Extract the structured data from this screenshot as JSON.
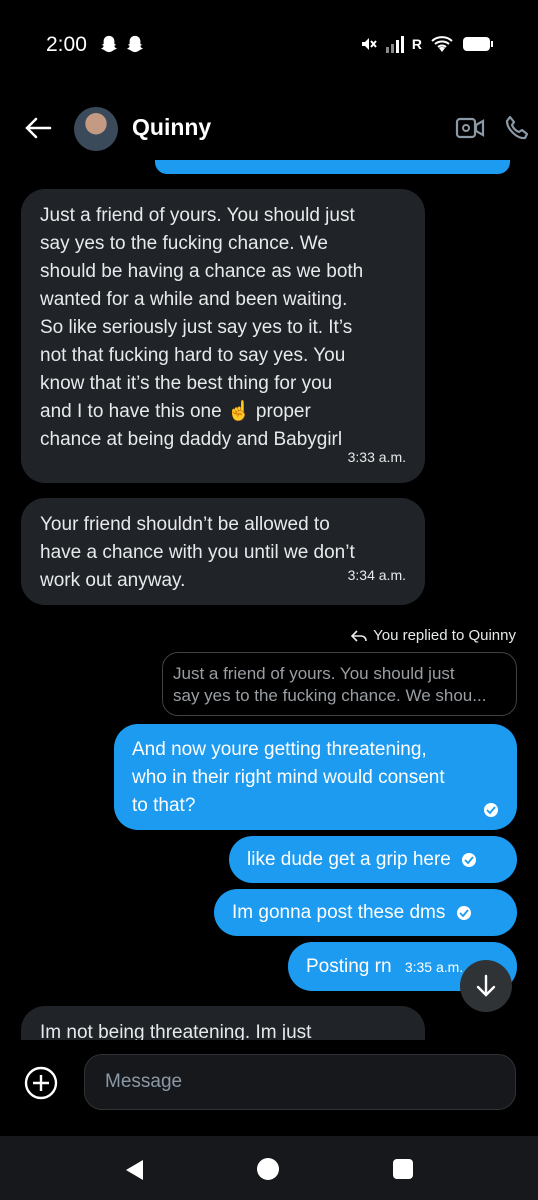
{
  "status_bar": {
    "time": "2:00",
    "network": "R"
  },
  "header": {
    "contact_name": "Quinny"
  },
  "messages": [
    {
      "direction": "incoming",
      "lines": [
        "Just a friend of yours. You should just",
        "say yes to the fucking chance. We",
        "should be having a chance as we both",
        "wanted for a while and been waiting.",
        "So like seriously just say yes to it. It’s",
        "not that fucking hard to say yes. You",
        "know that it’s the best thing for you",
        "and I to have this one ☝️ proper",
        "chance at being daddy and Babygirl"
      ],
      "time": "3:33 a.m."
    },
    {
      "direction": "incoming",
      "lines": [
        "Your friend shouldn’t be allowed to",
        "have a chance with you until we don’t",
        "work out anyway."
      ],
      "time": "3:34 a.m."
    },
    {
      "direction": "outgoing",
      "lines": [
        "And now youre getting threatening,",
        "who in their right mind would consent",
        "to that?"
      ]
    },
    {
      "direction": "outgoing",
      "lines": [
        "like dude get a grip here"
      ]
    },
    {
      "direction": "outgoing",
      "lines": [
        "Im gonna post these dms"
      ]
    },
    {
      "direction": "outgoing",
      "lines": [
        "Posting rn"
      ],
      "time": "3:35 a.m."
    },
    {
      "direction": "incoming",
      "lines": [
        "Im not being threatening. Im just"
      ]
    }
  ],
  "reply": {
    "label": "You replied to Quinny",
    "quote_lines": [
      "Just a friend of yours. You should just",
      "say yes to the fucking chance. We shou..."
    ]
  },
  "composer": {
    "placeholder": "Message"
  },
  "colors": {
    "accent": "#1d9bf0",
    "incoming_bubble": "#202327",
    "background": "#000000"
  }
}
